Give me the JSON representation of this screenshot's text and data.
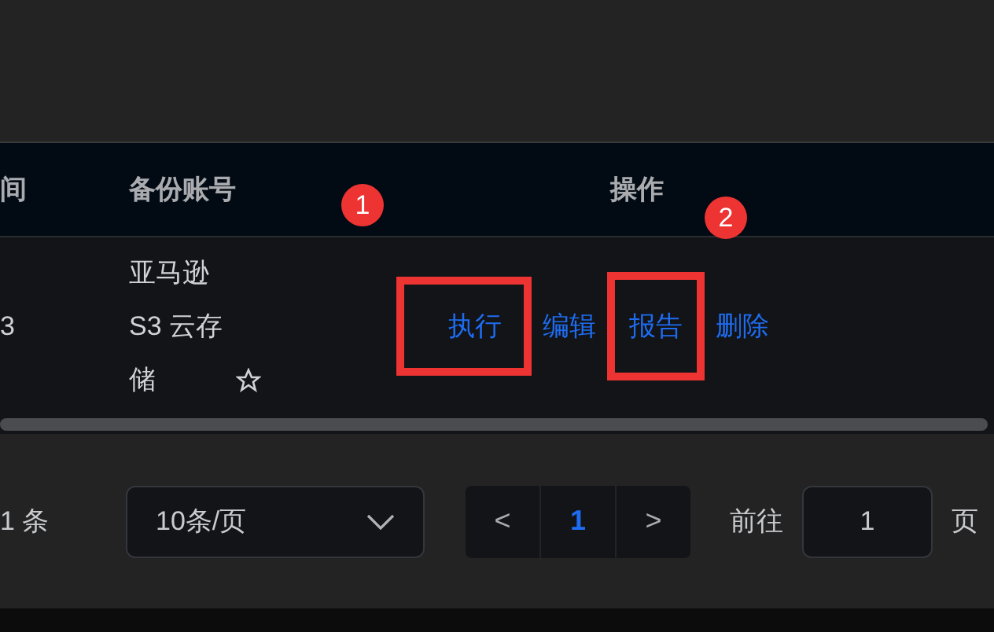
{
  "table": {
    "columns": [
      {
        "label": "间"
      },
      {
        "label": "备份账号"
      },
      {
        "label": "操作"
      }
    ],
    "rows": [
      {
        "cells": [
          "3",
          "亚马逊 S3 云存储"
        ],
        "starred": false,
        "actions": [
          {
            "label": "执行",
            "highlighted": true
          },
          {
            "label": "编辑",
            "highlighted": false
          },
          {
            "label": "报告",
            "highlighted": true
          },
          {
            "label": "删除",
            "highlighted": false
          }
        ]
      }
    ]
  },
  "annotations": [
    {
      "label": "1"
    },
    {
      "label": "2"
    }
  ],
  "pagination": {
    "total": "1 条",
    "page_size": "10条/页",
    "prev": "<",
    "pages": [
      {
        "label": "1",
        "selected": true
      }
    ],
    "next": ">",
    "goto_label": "前往",
    "goto_value": "1",
    "goto_suffix": "页"
  }
}
